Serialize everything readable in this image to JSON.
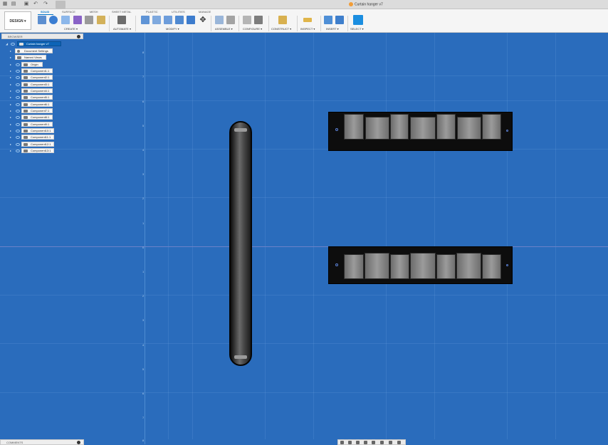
{
  "titlebar": {
    "title": "Curtain hanger v7",
    "icons": [
      "grid-icon",
      "file-icon",
      "save-icon",
      "undo-icon",
      "redo-icon",
      "home-icon"
    ]
  },
  "workspace": {
    "label": "DESIGN ▾"
  },
  "tabs": [
    {
      "label": "SOLID",
      "active": true
    },
    {
      "label": "SURFACE",
      "active": false
    },
    {
      "label": "MESH",
      "active": false
    },
    {
      "label": "SHEET METAL",
      "active": false
    },
    {
      "label": "PLASTIC",
      "active": false
    },
    {
      "label": "UTILITIES",
      "active": false
    },
    {
      "label": "MANAGE",
      "active": false
    }
  ],
  "groups": [
    {
      "label": "CREATE ▾"
    },
    {
      "label": "AUTOMATE ▾"
    },
    {
      "label": "MODIFY ▾"
    },
    {
      "label": "ASSEMBLE ▾"
    },
    {
      "label": "CONFIGURE ▾"
    },
    {
      "label": "CONSTRUCT ▾"
    },
    {
      "label": "INSPECT ▾"
    },
    {
      "label": "INSERT ▾"
    },
    {
      "label": "SELECT ▾"
    }
  ],
  "browser": {
    "header": "BROWSER",
    "root": "Curtain hanger v7",
    "items": [
      {
        "label": "Document Settings",
        "icon": "gear-icon"
      },
      {
        "label": "Named Views",
        "icon": "folder-icon"
      },
      {
        "label": "Origin",
        "icon": "folder-icon"
      },
      {
        "label": "Component1:1",
        "icon": "component-icon"
      },
      {
        "label": "Component2:1",
        "icon": "component-icon"
      },
      {
        "label": "Component3:1",
        "icon": "component-icon"
      },
      {
        "label": "Component4:1",
        "icon": "component-icon"
      },
      {
        "label": "Component5:1",
        "icon": "component-icon"
      },
      {
        "label": "Component6:1",
        "icon": "component-icon"
      },
      {
        "label": "Component7:1",
        "icon": "component-icon"
      },
      {
        "label": "Component8:1",
        "icon": "component-icon"
      },
      {
        "label": "Component9:1",
        "icon": "component-icon"
      },
      {
        "label": "Component10:1",
        "icon": "component-icon"
      },
      {
        "label": "Component11:1",
        "icon": "component-icon"
      },
      {
        "label": "Component12:1",
        "icon": "component-icon"
      },
      {
        "label": "Component13:1",
        "icon": "component-icon"
      }
    ]
  },
  "axis_ticks": [
    "8",
    "7",
    "6",
    "5",
    "4",
    "3",
    "2",
    "1",
    "0",
    "1",
    "2",
    "3",
    "4",
    "5",
    "6",
    "7",
    "8"
  ],
  "comments": {
    "label": "COMMENTS"
  },
  "colors": {
    "accent": "#0073c7",
    "canvas": "#2a6cbc"
  }
}
